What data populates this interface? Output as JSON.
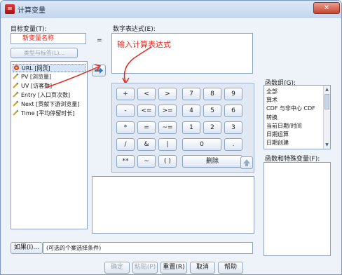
{
  "window": {
    "title": "计算变量",
    "close_label": "✕",
    "app_icon_glyph": "="
  },
  "target": {
    "label": "目标变量(T):",
    "value": "新变量名称",
    "equals": "=",
    "type_label_button": "类型与标签(L)..."
  },
  "expression": {
    "label": "数字表达式(E):",
    "annotation": "输入计算表达式"
  },
  "variables": [
    {
      "label": "URL [网页]",
      "icon": "string-variable-icon",
      "selected": true
    },
    {
      "label": "PV [浏览量]",
      "icon": "scale-variable-icon",
      "selected": false
    },
    {
      "label": "UV [访客数]",
      "icon": "scale-variable-icon",
      "selected": false
    },
    {
      "label": "Entry [入口页次数]",
      "icon": "scale-variable-icon",
      "selected": false
    },
    {
      "label": "Next [贡献下游浏览量]",
      "icon": "scale-variable-icon",
      "selected": false
    },
    {
      "label": "Time [平均停留时长]",
      "icon": "scale-variable-icon",
      "selected": false
    }
  ],
  "keypad": {
    "row1": [
      "+",
      "<",
      ">",
      "7",
      "8",
      "9"
    ],
    "row2": [
      "-",
      "<=",
      ">=",
      "4",
      "5",
      "6"
    ],
    "row3": [
      "*",
      "=",
      "~=",
      "1",
      "2",
      "3"
    ],
    "row4": [
      "/",
      "&",
      "|",
      "0",
      "."
    ],
    "row5": [
      "**",
      "~",
      "( )",
      "删除"
    ]
  },
  "function_group": {
    "label": "函数组(G):",
    "items": [
      "全部",
      "算术",
      "CDF 与非中心 CDF",
      "转换",
      "当前日期/时间",
      "日期运算",
      "日期创建"
    ]
  },
  "functions": {
    "label": "函数和特殊变量(F):"
  },
  "if_section": {
    "button": "如果(I)...",
    "note": "(可选的个案选择条件)"
  },
  "footer": {
    "ok": "确定",
    "paste": "粘贴(P)",
    "reset": "重置(R)",
    "cancel": "取消",
    "help": "帮助"
  },
  "colors": {
    "annotation": "#e0281e",
    "accent": "#3f6fb5"
  }
}
